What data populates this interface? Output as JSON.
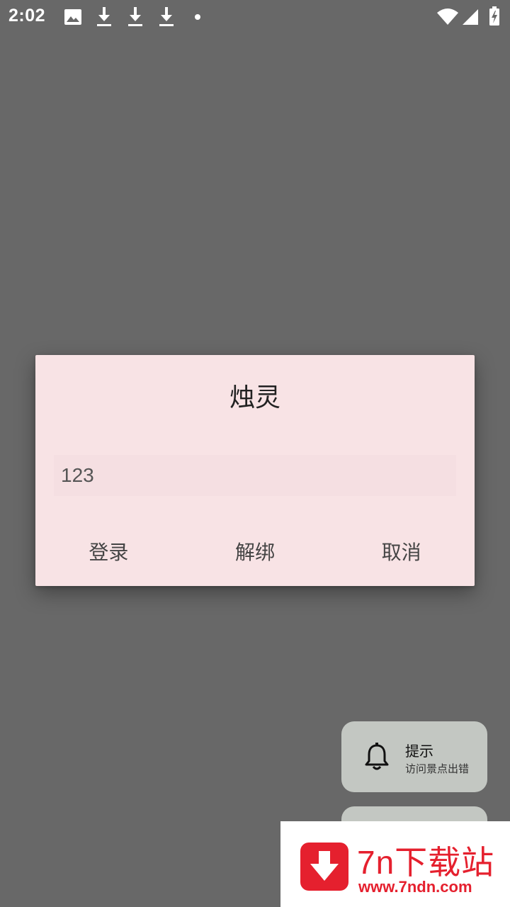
{
  "status_bar": {
    "time": "2:02",
    "icons": [
      "image-icon",
      "download-icon",
      "download-icon",
      "download-icon",
      "dot-icon",
      "wifi-icon",
      "signal-icon",
      "battery-charging-icon"
    ]
  },
  "dialog": {
    "title": "烛灵",
    "input_value": "123",
    "buttons": {
      "login": "登录",
      "unbind": "解绑",
      "cancel": "取消"
    }
  },
  "notification": {
    "icon": "bell-icon",
    "title": "提示",
    "message": "访问景点出错"
  },
  "watermark": {
    "name": "7n下载站",
    "url": "www.7ndn.com",
    "color": "#e5202e"
  },
  "colors": {
    "overlay": "#686868",
    "dialog_bg": "#f8e3e5",
    "chip_bg": "#c3c7c2"
  }
}
